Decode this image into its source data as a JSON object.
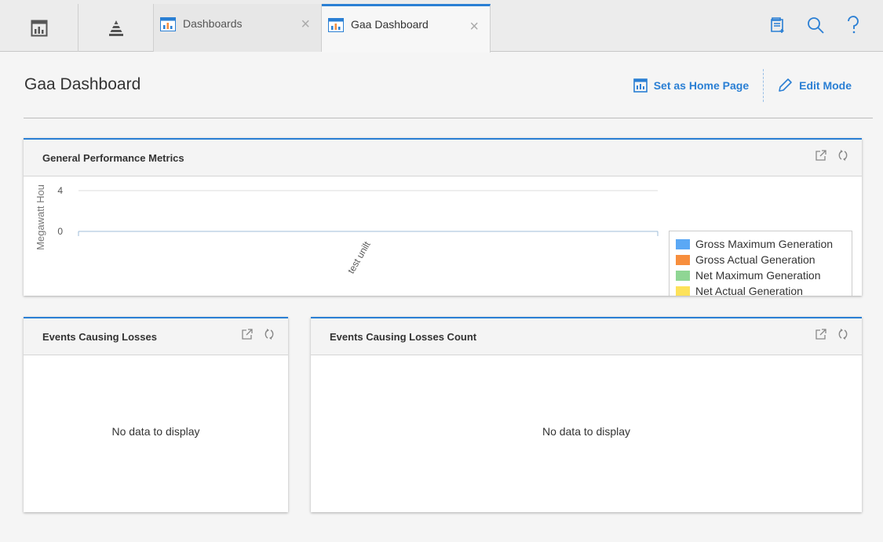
{
  "tabs": [
    {
      "label": "Dashboards"
    },
    {
      "label": "Gaa Dashboard"
    }
  ],
  "page": {
    "title": "Gaa Dashboard",
    "set_home_label": "Set as Home Page",
    "edit_mode_label": "Edit Mode"
  },
  "panels": {
    "performance": {
      "title": "General Performance Metrics"
    },
    "events_losses": {
      "title": "Events Causing Losses",
      "empty_text": "No data to display"
    },
    "events_losses_count": {
      "title": "Events Causing Losses Count",
      "empty_text": "No data to display"
    }
  },
  "colors": {
    "accent": "#2a7fd4"
  },
  "chart_data": {
    "type": "bar",
    "title": "",
    "categories": [
      "test unilt"
    ],
    "ylabel": "Megawatt Hou",
    "yticks": [
      "4",
      "0"
    ],
    "ylim": [
      0,
      4
    ],
    "grid": true,
    "legend_position": "bottom-right",
    "series": [
      {
        "name": "Gross Maximum Generation",
        "color": "#5ba8f5",
        "values": [
          0
        ]
      },
      {
        "name": "Gross Actual Generation",
        "color": "#f78e3d",
        "values": [
          0
        ]
      },
      {
        "name": "Net Maximum Generation",
        "color": "#8fd694",
        "values": [
          0
        ]
      },
      {
        "name": "Net Actual Generation",
        "color": "#fde25a",
        "values": [
          0
        ]
      }
    ]
  }
}
